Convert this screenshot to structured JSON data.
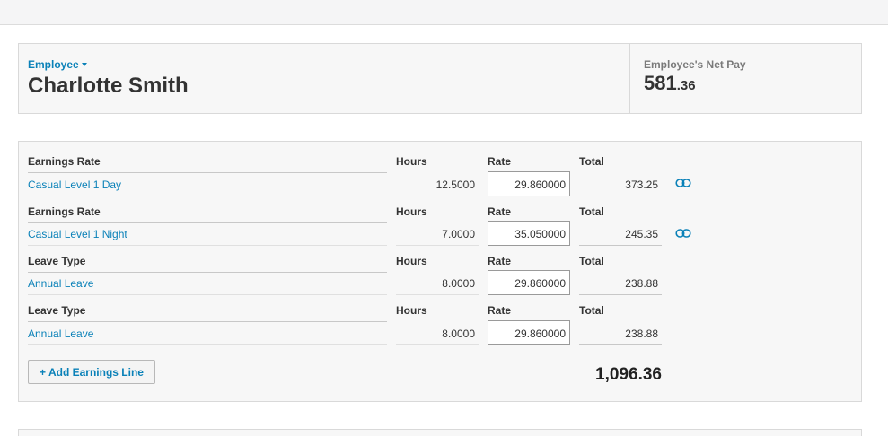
{
  "employee": {
    "label": "Employee",
    "name": "Charlotte Smith",
    "net_pay_label": "Employee's Net Pay",
    "net_pay_main": "581",
    "net_pay_decimal": ".36"
  },
  "earnings": {
    "lines": [
      {
        "type_header": "Earnings Rate",
        "type": "Casual Level 1 Day",
        "hours_header": "Hours",
        "hours": "12.5000",
        "rate_header": "Rate",
        "rate": "29.860000",
        "total_header": "Total",
        "total": "373.25",
        "has_link": true
      },
      {
        "type_header": "Earnings Rate",
        "type": "Casual Level 1 Night",
        "hours_header": "Hours",
        "hours": "7.0000",
        "rate_header": "Rate",
        "rate": "35.050000",
        "total_header": "Total",
        "total": "245.35",
        "has_link": true
      },
      {
        "type_header": "Leave Type",
        "type": "Annual Leave",
        "hours_header": "Hours",
        "hours": "8.0000",
        "rate_header": "Rate",
        "rate": "29.860000",
        "total_header": "Total",
        "total": "238.88",
        "has_link": false
      },
      {
        "type_header": "Leave Type",
        "type": "Annual Leave",
        "hours_header": "Hours",
        "hours": "8.0000",
        "rate_header": "Rate",
        "rate": "29.860000",
        "total_header": "Total",
        "total": "238.88",
        "has_link": false
      }
    ],
    "add_button_label": "+ Add Earnings Line",
    "grand_total": "1,096.36"
  },
  "icons": {
    "link": "link-icon",
    "dropdown": "caret-down-icon"
  },
  "colors": {
    "accent": "#0a81b8",
    "card_bg": "#f7f7f7",
    "border": "#d9d9d9"
  }
}
